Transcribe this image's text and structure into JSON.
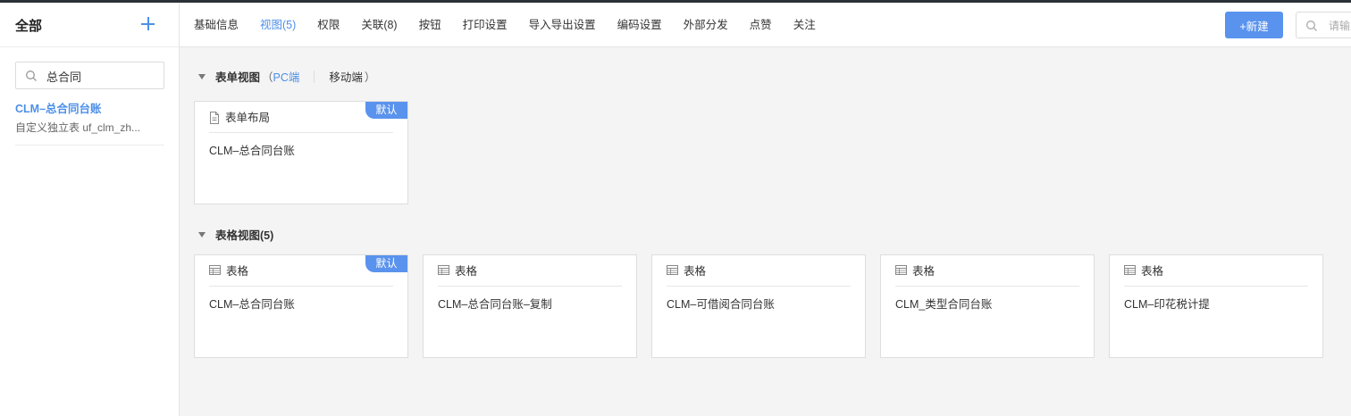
{
  "sidebar": {
    "title": "全部",
    "search_value": "总合同",
    "items": [
      {
        "name": "CLM–总合同台账",
        "subtitle": "自定义独立表 uf_clm_zh..."
      }
    ]
  },
  "topbar": {
    "tabs": [
      "基础信息",
      "视图(5)",
      "权限",
      "关联(8)",
      "按钮",
      "打印设置",
      "导入导出设置",
      "编码设置",
      "外部分发",
      "点赞",
      "关注"
    ],
    "active_tab": "视图(5)",
    "new_button": "+新建",
    "search_placeholder": "请输入"
  },
  "form_view": {
    "title": "表单视图",
    "paren_open": "（",
    "pc": "PC端",
    "mobile": "移动端",
    "paren_close": "）",
    "cards": [
      {
        "type_label": "表单布局",
        "icon": "document-icon",
        "name": "CLM–总合同台账",
        "badge": "默认"
      }
    ]
  },
  "table_view": {
    "title": "表格视图(5)",
    "cards": [
      {
        "type_label": "表格",
        "icon": "table-icon",
        "name": "CLM–总合同台账",
        "badge": "默认"
      },
      {
        "type_label": "表格",
        "icon": "table-icon",
        "name": "CLM–总合同台账–复制",
        "badge": ""
      },
      {
        "type_label": "表格",
        "icon": "table-icon",
        "name": "CLM–可借阅合同台账",
        "badge": ""
      },
      {
        "type_label": "表格",
        "icon": "table-icon",
        "name": "CLM_类型合同台账",
        "badge": ""
      },
      {
        "type_label": "表格",
        "icon": "table-icon",
        "name": "CLM–印花税计提",
        "badge": ""
      }
    ]
  },
  "colors": {
    "accent": "#4d8fe8",
    "button": "#5a93ee",
    "background": "#f4f4f4"
  }
}
